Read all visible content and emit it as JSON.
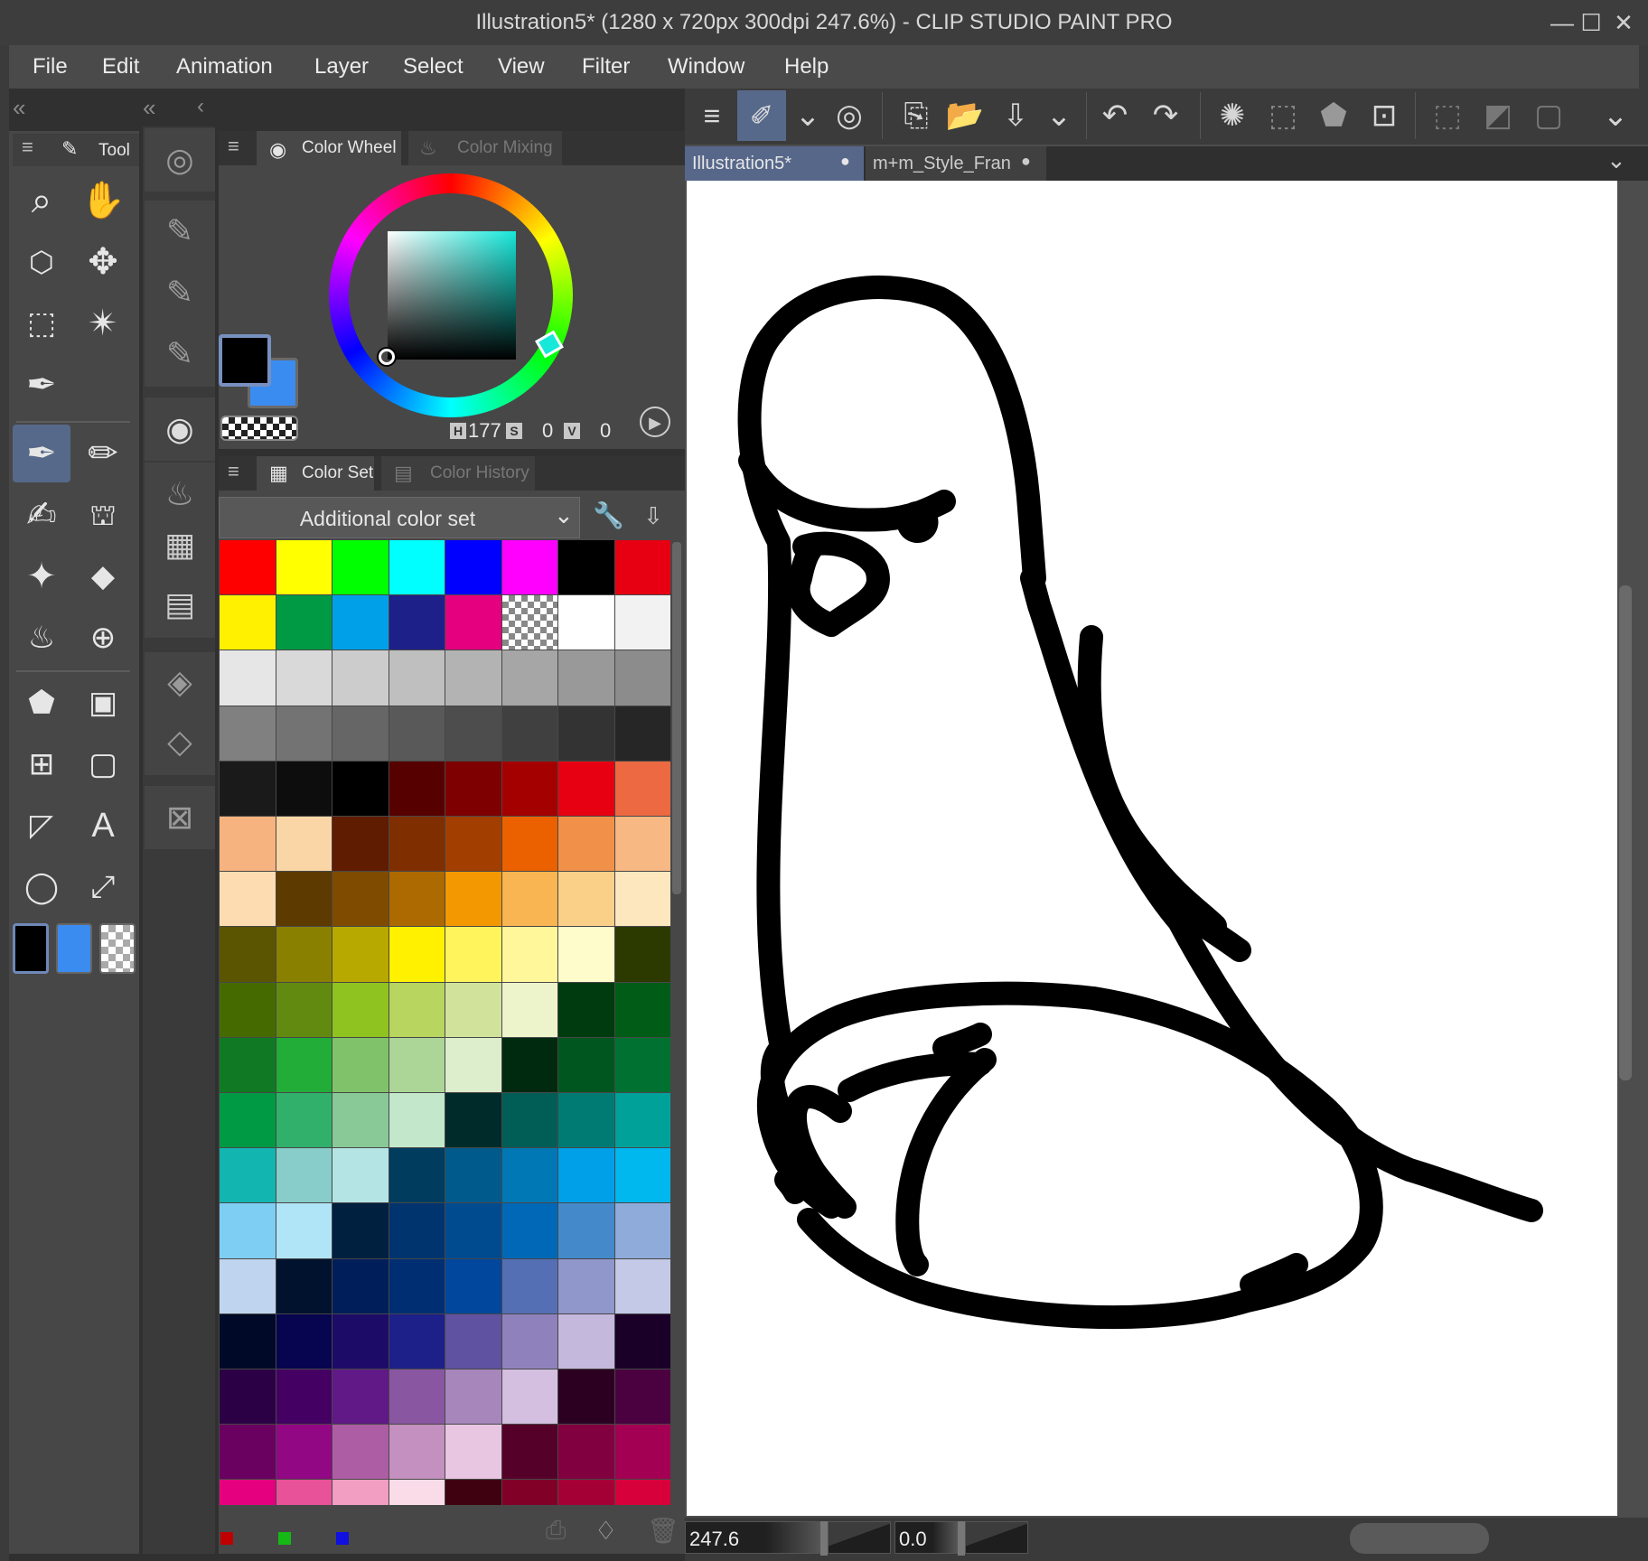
{
  "window": {
    "title": "Illustration5* (1280 x 720px 300dpi 247.6%)  - CLIP STUDIO PAINT PRO",
    "minimize": "—",
    "maximize": "☐",
    "close": "✕"
  },
  "menu": [
    "File",
    "Edit",
    "Animation",
    "Layer",
    "Select",
    "View",
    "Filter",
    "Window",
    "Help"
  ],
  "tool_panel": {
    "tab_label": "Tool"
  },
  "color_panel": {
    "tab_wheel": "Color Wheel",
    "tab_mixing": "Color Mixing",
    "h_label": "H",
    "h_value": "177",
    "s_label": "S",
    "s_value": "0",
    "v_label": "V",
    "v_value": "0",
    "main_color": "#000000",
    "sub_color": "#3b8cf0"
  },
  "color_set_panel": {
    "tab_set": "Color Set",
    "tab_history": "Color History",
    "selected_set": "Additional color set"
  },
  "swatches": [
    "#ff0000",
    "#ffff00",
    "#00ff00",
    "#00ffff",
    "#0000ff",
    "#ff00ff",
    "#000000",
    "#e60012",
    "#fff100",
    "#009944",
    "#00a0e9",
    "#1d2088",
    "#e4007f",
    "checker",
    "#ffffff",
    "#f2f2f2",
    "#e6e6e6",
    "#d9d9d9",
    "#cccccc",
    "#bfbfbf",
    "#b3b3b3",
    "#a6a6a6",
    "#999999",
    "#8c8c8c",
    "#808080",
    "#737373",
    "#666666",
    "#595959",
    "#4d4d4d",
    "#404040",
    "#333333",
    "#262626",
    "#1a1a1a",
    "#0d0d0d",
    "#000000",
    "#570000",
    "#7f0000",
    "#a40000",
    "#e60012",
    "#ec6941",
    "#f6b37f",
    "#fad5a5",
    "#5f1c00",
    "#7f2e00",
    "#a23e00",
    "#eb6100",
    "#f19149",
    "#f7b884",
    "#fcdcb0",
    "#5c3a00",
    "#7f4b00",
    "#ad6a00",
    "#f39800",
    "#f8b551",
    "#fad089",
    "#fce7bf",
    "#5b5400",
    "#8a8000",
    "#b8a900",
    "#fff100",
    "#fff45c",
    "#fff799",
    "#fffccc",
    "#2c3a00",
    "#456b00",
    "#628a10",
    "#8fc31f",
    "#b7d55f",
    "#d1e39b",
    "#edf4cb",
    "#003a0f",
    "#005c16",
    "#0f7a23",
    "#22ac38",
    "#80c269",
    "#acd598",
    "#dceecb",
    "#002a10",
    "#00561f",
    "#007130",
    "#009944",
    "#31b06c",
    "#89c997",
    "#c2e7ca",
    "#002b2b",
    "#005e56",
    "#007b74",
    "#00a199",
    "#13b5b1",
    "#88cdc9",
    "#b4e5e4",
    "#003c5e",
    "#005a8b",
    "#0078b5",
    "#00a0e9",
    "#00b7ee",
    "#7ecef4",
    "#b0e5f8",
    "#00203f",
    "#00346f",
    "#004b8f",
    "#0068b7",
    "#448aca",
    "#8fabd9",
    "#bfd4ee",
    "#00122e",
    "#001f5a",
    "#002e73",
    "#00479d",
    "#556fb5",
    "#8f97cb",
    "#c3c9e7",
    "#000a28",
    "#070450",
    "#1d0b68",
    "#1d2088",
    "#5f52a0",
    "#8f82bc",
    "#c4b8dd",
    "#1a0028",
    "#2b0044",
    "#440062",
    "#601986",
    "#8957a1",
    "#a686bb",
    "#d4bfe0",
    "#2b0021",
    "#4b0040",
    "#6a005f",
    "#920783",
    "#ad5da4",
    "#c490bf",
    "#e8c6e2",
    "#550029",
    "#800040",
    "#a40053"
  ],
  "swatch_bottom_row": [
    "#e4007f",
    "#e85298",
    "#f19ec2",
    "#fadce9",
    "#3f000f",
    "#800028",
    "#a40035",
    "#d7003a"
  ],
  "status": {
    "zoom": "247.6",
    "angle": "0.0"
  },
  "documents": [
    {
      "label": "Illustration5*",
      "active": true
    },
    {
      "label": "m+m_Style_Fran",
      "active": false
    }
  ]
}
